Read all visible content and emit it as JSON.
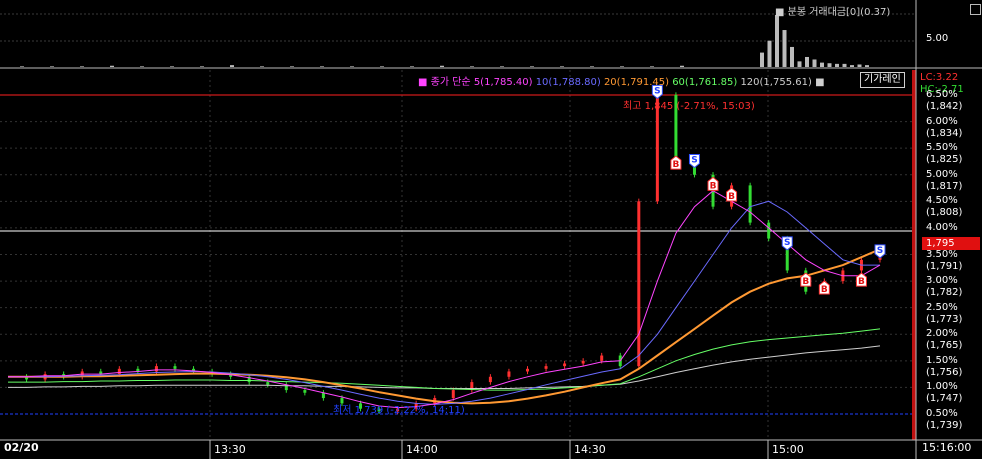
{
  "volume_panel": {
    "title": "분봉 거래대금[0](0.37)",
    "axis_label": "5.00",
    "chart_data": {
      "type": "bar",
      "title": "분봉 거래대금[0](0.37)",
      "values": [
        0.1,
        0.1,
        0.1,
        0.2,
        0.1,
        0.1,
        0.1,
        0.3,
        0.1,
        0.1,
        0.1,
        0.1,
        0.1,
        0.1,
        0.2,
        0.1,
        0.1,
        0.1,
        0.1,
        0.1,
        0.1,
        0.1,
        0.2,
        2.3,
        4.2,
        8.3,
        5.9,
        3.2,
        0.9,
        1.6,
        1.2,
        0.7,
        0.6,
        0.5,
        0.5,
        0.3,
        0.4,
        0.3
      ]
    }
  },
  "price_panel": {
    "legend": {
      "title": "종가 단순",
      "items": [
        {
          "label": "5(1,785.40)",
          "color": "#ff44ff"
        },
        {
          "label": "10(1,788.80)",
          "color": "#6a6aff"
        },
        {
          "label": "20(1,791.45)",
          "color": "#ff9933"
        },
        {
          "label": "60(1,761.85)",
          "color": "#66ff66"
        },
        {
          "label": "120(1,755.61)",
          "color": "#cfcfcf"
        }
      ]
    },
    "giga_button": "기가레인",
    "high_label": "최고 1,845 (-2.71%, 15:03)",
    "low_label": "최저 1,739 (-2.22%, 14:11)",
    "lc_label": "LC:3.22",
    "hc_label": "HC:-2.71",
    "current_price": "1,795",
    "right_axis": [
      {
        "pct": "6.50%",
        "price": "(1,842)"
      },
      {
        "pct": "6.00%",
        "price": "(1,834)"
      },
      {
        "pct": "5.50%",
        "price": "(1,825)"
      },
      {
        "pct": "5.00%",
        "price": "(1,817)"
      },
      {
        "pct": "4.50%",
        "price": "(1,808)"
      },
      {
        "pct": "4.00%",
        "price": ""
      },
      {
        "pct": "3.50%",
        "price": "(1,791)"
      },
      {
        "pct": "3.00%",
        "price": "(1,782)"
      },
      {
        "pct": "2.50%",
        "price": "(1,773)"
      },
      {
        "pct": "2.00%",
        "price": "(1,765)"
      },
      {
        "pct": "1.50%",
        "price": "(1,756)"
      },
      {
        "pct": "1.00%",
        "price": "(1,747)"
      },
      {
        "pct": "0.50%",
        "price": "(1,739)"
      }
    ],
    "chart_data": {
      "type": "line",
      "y_unit": "percent",
      "ylim": [
        0.4,
        6.8
      ],
      "close_series": [
        1.2,
        1.15,
        1.25,
        1.2,
        1.3,
        1.25,
        1.35,
        1.3,
        1.4,
        1.35,
        1.3,
        1.25,
        1.2,
        1.1,
        1.05,
        0.95,
        0.9,
        0.8,
        0.7,
        0.6,
        0.55,
        0.6,
        0.7,
        0.8,
        0.95,
        1.1,
        1.2,
        1.3,
        1.35,
        1.4,
        1.45,
        1.5,
        1.6,
        1.4,
        4.5,
        6.5,
        5.2,
        5.0,
        4.4,
        4.8,
        4.1,
        3.8,
        3.2,
        2.8,
        3.0,
        3.2,
        3.4,
        3.6
      ],
      "ma5": [
        1.2,
        1.2,
        1.22,
        1.22,
        1.25,
        1.25,
        1.28,
        1.3,
        1.33,
        1.33,
        1.31,
        1.28,
        1.24,
        1.18,
        1.12,
        1.05,
        0.98,
        0.9,
        0.82,
        0.73,
        0.65,
        0.62,
        0.64,
        0.69,
        0.77,
        0.89,
        1.0,
        1.11,
        1.2,
        1.28,
        1.34,
        1.4,
        1.48,
        1.5,
        2.0,
        3.0,
        3.9,
        4.4,
        4.7,
        4.5,
        4.3,
        4.0,
        3.7,
        3.4,
        3.2,
        3.1,
        3.1,
        3.3
      ],
      "ma10": [
        1.2,
        1.2,
        1.2,
        1.21,
        1.22,
        1.23,
        1.24,
        1.26,
        1.28,
        1.29,
        1.3,
        1.29,
        1.27,
        1.24,
        1.2,
        1.15,
        1.09,
        1.02,
        0.95,
        0.87,
        0.8,
        0.74,
        0.7,
        0.68,
        0.7,
        0.74,
        0.8,
        0.88,
        0.96,
        1.05,
        1.13,
        1.21,
        1.29,
        1.35,
        1.6,
        2.0,
        2.5,
        3.0,
        3.5,
        4.0,
        4.4,
        4.5,
        4.3,
        4.0,
        3.7,
        3.4,
        3.3,
        3.3
      ],
      "ma20": [
        1.2,
        1.2,
        1.2,
        1.2,
        1.21,
        1.21,
        1.22,
        1.23,
        1.24,
        1.25,
        1.26,
        1.26,
        1.25,
        1.24,
        1.22,
        1.19,
        1.15,
        1.1,
        1.04,
        0.98,
        0.91,
        0.85,
        0.79,
        0.74,
        0.71,
        0.7,
        0.71,
        0.74,
        0.79,
        0.85,
        0.92,
        1.0,
        1.08,
        1.15,
        1.35,
        1.6,
        1.85,
        2.1,
        2.35,
        2.6,
        2.8,
        2.95,
        3.05,
        3.1,
        3.2,
        3.3,
        3.45,
        3.6
      ],
      "ma60": [
        1.1,
        1.1,
        1.1,
        1.11,
        1.11,
        1.12,
        1.12,
        1.13,
        1.13,
        1.14,
        1.14,
        1.14,
        1.13,
        1.13,
        1.12,
        1.11,
        1.1,
        1.09,
        1.08,
        1.06,
        1.04,
        1.02,
        1.0,
        0.98,
        0.97,
        0.96,
        0.95,
        0.95,
        0.96,
        0.97,
        0.99,
        1.01,
        1.04,
        1.07,
        1.2,
        1.35,
        1.5,
        1.62,
        1.72,
        1.8,
        1.86,
        1.9,
        1.93,
        1.96,
        1.99,
        2.02,
        2.06,
        2.1
      ],
      "ma120": [
        1.0,
        1.0,
        1.01,
        1.01,
        1.02,
        1.02,
        1.03,
        1.03,
        1.04,
        1.04,
        1.04,
        1.04,
        1.04,
        1.04,
        1.04,
        1.03,
        1.03,
        1.02,
        1.02,
        1.01,
        1.0,
        0.99,
        0.99,
        0.98,
        0.98,
        0.98,
        0.98,
        0.98,
        0.99,
        1.0,
        1.01,
        1.02,
        1.04,
        1.06,
        1.12,
        1.2,
        1.28,
        1.35,
        1.42,
        1.48,
        1.53,
        1.57,
        1.61,
        1.65,
        1.68,
        1.71,
        1.74,
        1.78
      ],
      "signals": [
        {
          "type": "S",
          "i": 35,
          "y": 6.55
        },
        {
          "type": "B",
          "i": 36,
          "y": 5.2
        },
        {
          "type": "S",
          "i": 37,
          "y": 5.25
        },
        {
          "type": "B",
          "i": 38,
          "y": 4.8
        },
        {
          "type": "B",
          "i": 39,
          "y": 4.6
        },
        {
          "type": "S",
          "i": 42,
          "y": 3.7
        },
        {
          "type": "B",
          "i": 43,
          "y": 3.0
        },
        {
          "type": "B",
          "i": 44,
          "y": 2.85
        },
        {
          "type": "B",
          "i": 46,
          "y": 3.0
        },
        {
          "type": "S",
          "i": 47,
          "y": 3.55
        }
      ]
    }
  },
  "time_axis": {
    "date": "02/20",
    "ticks": [
      "13:30",
      "14:00",
      "14:30",
      "15:00"
    ],
    "current_time": "15:16:00"
  },
  "colors": {
    "up": "#ff3030",
    "down": "#33dd33",
    "grid": "#4a4a4a",
    "high_line": "#ff2020",
    "low_line": "#2040ff"
  }
}
